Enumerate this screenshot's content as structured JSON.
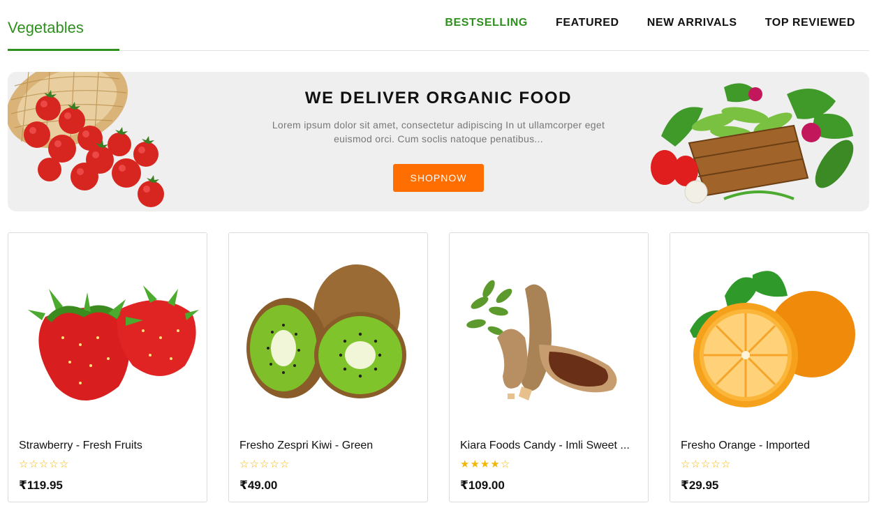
{
  "header": {
    "title": "Vegetables",
    "tabs": [
      {
        "label": "BESTSELLING",
        "active": true
      },
      {
        "label": "FEATURED",
        "active": false
      },
      {
        "label": "NEW ARRIVALS",
        "active": false
      },
      {
        "label": "TOP REVIEWED",
        "active": false
      }
    ]
  },
  "banner": {
    "title": "WE DELIVER ORGANIC FOOD",
    "text": "Lorem ipsum dolor sit amet, consectetur adipiscing In ut ullamcorper eget euismod orci. Cum soclis natoque penatibus...",
    "button_label": "SHOPNOW",
    "left_image": "tomatoes-basket",
    "right_image": "vegetable-crate"
  },
  "products": [
    {
      "name": "Strawberry - Fresh Fruits",
      "rating": 0,
      "max_rating": 5,
      "price": "₹119.95",
      "image": "strawberry"
    },
    {
      "name": "Fresho Zespri Kiwi - Green",
      "rating": 0,
      "max_rating": 5,
      "price": "₹49.00",
      "image": "kiwi"
    },
    {
      "name": "Kiara Foods Candy - Imli Sweet ...",
      "rating": 4,
      "max_rating": 5,
      "price": "₹109.00",
      "image": "tamarind"
    },
    {
      "name": "Fresho Orange - Imported",
      "rating": 0,
      "max_rating": 5,
      "price": "₹29.95",
      "image": "orange"
    }
  ],
  "colors": {
    "accent_green": "#2f8f1f",
    "button_orange": "#ff6e00",
    "star_gold": "#f2b705",
    "banner_bg": "#efefef"
  }
}
